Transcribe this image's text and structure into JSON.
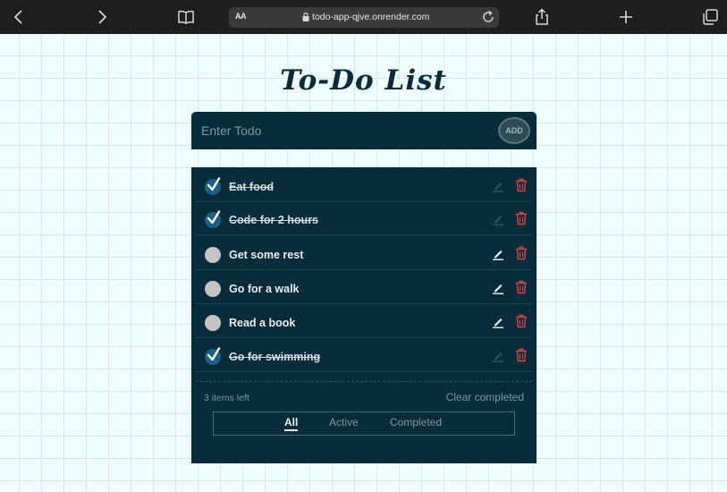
{
  "browser": {
    "text_size_label": "AA",
    "url": "todo-app-qjve.onrender.com"
  },
  "app": {
    "title": "To-Do List",
    "input_placeholder": "Enter Todo",
    "input_value": "",
    "add_label": "ADD",
    "todos": [
      {
        "text": "Eat food",
        "completed": true
      },
      {
        "text": "Code for 2 hours",
        "completed": true
      },
      {
        "text": "Get some rest",
        "completed": false
      },
      {
        "text": "Go for a walk",
        "completed": false
      },
      {
        "text": "Read a book",
        "completed": false
      },
      {
        "text": "Go for swimming",
        "completed": true
      }
    ],
    "items_left": "3 items left",
    "clear_completed": "Clear completed",
    "filters": [
      "All",
      "Active",
      "Completed"
    ],
    "active_filter": "All"
  },
  "colors": {
    "panel": "#082c3a",
    "title": "#0b2b3a",
    "checked": "#1b5f83",
    "unchecked": "#c4c4c4",
    "delete": "#d9434a"
  }
}
